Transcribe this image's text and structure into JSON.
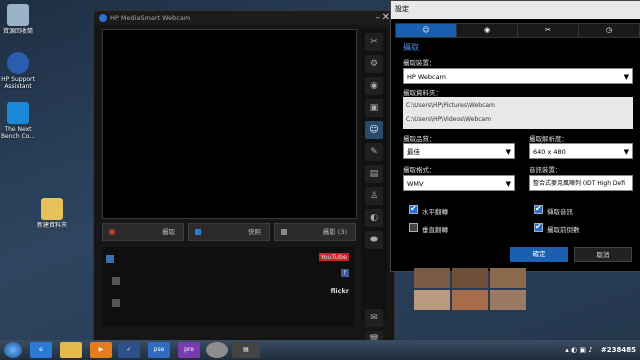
{
  "desktop": {
    "icons": [
      {
        "label": "資源回收筒",
        "icon": "recycle-bin-icon",
        "color": "#9bb3c9"
      },
      {
        "label": "HP Support Assistant",
        "icon": "hp-support-icon",
        "color": "#2a5db0"
      },
      {
        "label": "The Next Bench Co...",
        "icon": "next-bench-icon",
        "color": "#1e88d8"
      },
      {
        "label": "新建資料夾",
        "icon": "folder-icon",
        "color": "#e6c25a"
      }
    ]
  },
  "webcam": {
    "title": "HP MediaSmart Webcam",
    "capture_label": "攝取",
    "snapshot_label": "快照",
    "album_label": "攝影 (3)",
    "brands": [
      "YouTube",
      "f",
      "flickr"
    ]
  },
  "dialog": {
    "title": "設定",
    "section": "攝取",
    "device_label": "攝取裝置：",
    "device_value": "HP Webcam",
    "folder_label": "攝取資料夾：",
    "paths": [
      "C:\\Users\\HP\\Pictures\\Webcam",
      "C:\\Users\\HP\\Videos\\Webcam"
    ],
    "quality_label": "攝取品質：",
    "quality_value": "最佳",
    "resolution_label": "攝取解析度：",
    "resolution_value": "640 x 480",
    "format_label": "攝取格式：",
    "format_value": "WMV",
    "audio_label": "音訊裝置：",
    "audio_value": "整合式麥克風陣列 (IDT High Defi",
    "check_hflip": "水平翻轉",
    "check_vflip": "垂直翻轉",
    "check_audio": "擷取音訊",
    "check_countdown": "攝取前倒數",
    "ok_label": "確定",
    "cancel_label": "取消",
    "accent": "#1b5fb0"
  },
  "taskbar": {
    "apps": [
      "ie-icon",
      "explorer-icon",
      "media-player-icon",
      "hp-icon",
      "pse-icon",
      "pre-icon",
      "webcam-app-icon",
      "film-icon"
    ],
    "pse": "pse",
    "pre": "pre",
    "watermark": "#238485"
  }
}
